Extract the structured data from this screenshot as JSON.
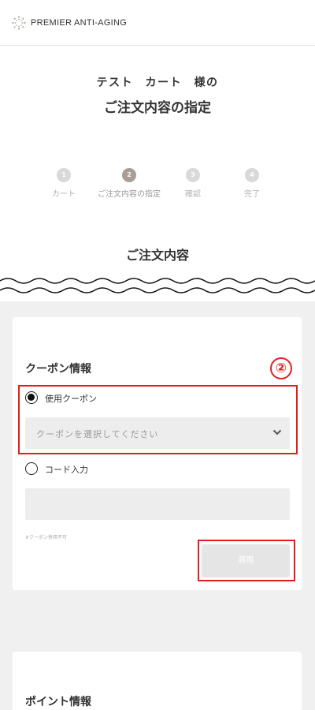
{
  "header": {
    "logo_text": "PREMIER ANTI-AGING"
  },
  "customer_line": "テスト　カート　様の",
  "page_title": "ご注文内容の指定",
  "steps": [
    {
      "number": "1",
      "label": "カート",
      "active": false
    },
    {
      "number": "2",
      "label": "ご注文内容の指定",
      "active": true
    },
    {
      "number": "3",
      "label": "確認",
      "active": false
    },
    {
      "number": "4",
      "label": "完了",
      "active": false
    }
  ],
  "section_title": "ご注文内容",
  "coupon": {
    "heading": "クーポン情報",
    "annotation_badge": "②",
    "option_use": {
      "label": "使用クーポン",
      "checked": true
    },
    "select_placeholder": "クーポンを選択してください",
    "option_code": {
      "label": "コード入力",
      "checked": false
    },
    "code_value": "",
    "note": "※クーポン併用不可",
    "apply_label": "適用"
  },
  "point": {
    "heading": "ポイント情報"
  },
  "colors": {
    "annotation_red": "#e02020",
    "active_step": "#a89e95",
    "inactive_step": "#d9d9d9",
    "background_gray": "#f0f0f0"
  },
  "icons": {
    "logo": "sunburst-logo-icon",
    "select": "chevron-down-icon"
  }
}
